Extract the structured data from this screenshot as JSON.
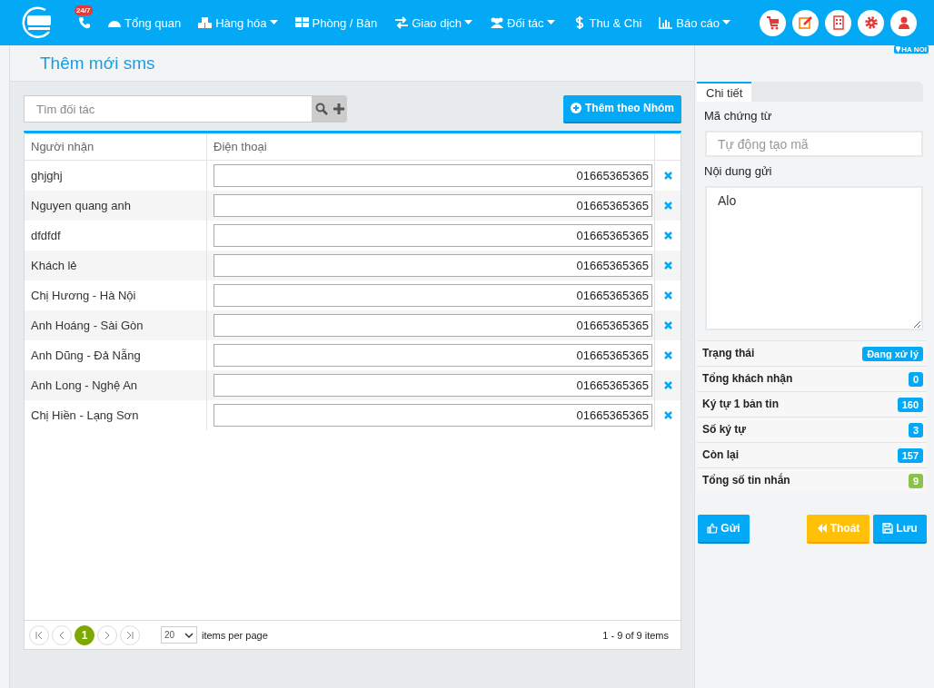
{
  "topbar": {
    "hotline_badge": "24/7",
    "menu": [
      {
        "label": "Tổng quan",
        "dropdown": false
      },
      {
        "label": "Hàng hóa",
        "dropdown": true
      },
      {
        "label": "Phòng / Bàn",
        "dropdown": false
      },
      {
        "label": "Giao dịch",
        "dropdown": true
      },
      {
        "label": "Đối tác",
        "dropdown": true
      },
      {
        "label": "Thu & Chi",
        "dropdown": false
      },
      {
        "label": "Báo cáo",
        "dropdown": true
      }
    ],
    "location": "HA NOI"
  },
  "page_title": "Thêm mới sms",
  "search": {
    "placeholder": "Tìm đối tác"
  },
  "add_group_button": "Thêm theo Nhóm",
  "table": {
    "columns": [
      "Người nhận",
      "Điện thoại"
    ],
    "rows": [
      {
        "name": "ghjghj",
        "phone": "01665365365"
      },
      {
        "name": "Nguyen quang anh",
        "phone": "01665365365"
      },
      {
        "name": "dfdfdf",
        "phone": "01665365365"
      },
      {
        "name": "Khách lẻ",
        "phone": "01665365365"
      },
      {
        "name": "Chị Hương - Hà Nội",
        "phone": "01665365365"
      },
      {
        "name": "Anh Hoáng - Sài Gòn",
        "phone": "01665365365"
      },
      {
        "name": "Anh Dũng - Đả Nẵng",
        "phone": "01665365365"
      },
      {
        "name": "Anh Long - Nghệ An",
        "phone": "01665365365"
      },
      {
        "name": "Chị Hiền - Lạng Sơn",
        "phone": "01665365365"
      }
    ]
  },
  "pager": {
    "pages": [
      {
        "label": "1",
        "selected": true
      }
    ],
    "page_size": "20",
    "page_size_label": "items per page",
    "summary": "1 - 9 of 9 items"
  },
  "detail": {
    "tabs": [
      {
        "label": "Chi tiết",
        "selected": true
      }
    ],
    "code_label": "Mã chứng từ",
    "code_placeholder": "Tự động tạo mã",
    "content_label": "Nội dung gửi",
    "content_value": "Alo",
    "stats": [
      {
        "label": "Trạng thái",
        "value": "Đang xử lý",
        "color": "#03a9f4"
      },
      {
        "label": "Tổng khách nhận",
        "value": "0",
        "color": "#03a9f4"
      },
      {
        "label": "Ký tự 1 bản tin",
        "value": "160",
        "color": "#03a9f4"
      },
      {
        "label": "Số ký tự",
        "value": "3",
        "color": "#03a9f4"
      },
      {
        "label": "Còn lại",
        "value": "157",
        "color": "#03a9f4"
      },
      {
        "label": "Tổng số tin nhắn",
        "value": "9",
        "color": "#8bc34a"
      }
    ],
    "buttons": [
      {
        "label": "Gửi",
        "kind": "send"
      },
      {
        "label": "Thoát",
        "kind": "exit"
      },
      {
        "label": "Lưu",
        "kind": "save"
      }
    ]
  }
}
